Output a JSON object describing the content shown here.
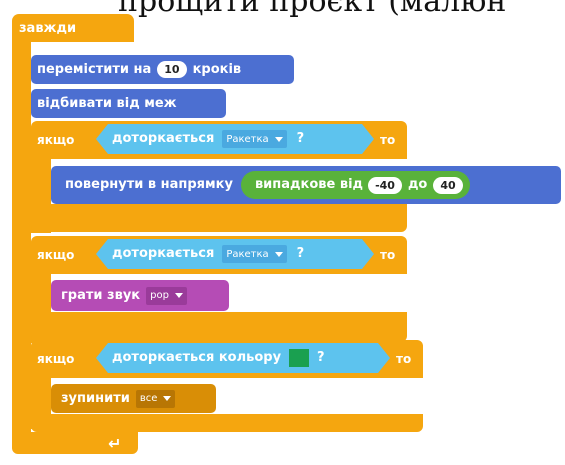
{
  "caption": "прощити проєкт (малюн",
  "script": {
    "forever_label": "завжди",
    "move": {
      "prefix": "перемістити на",
      "steps": "10",
      "suffix": "кроків"
    },
    "bounce_label": "відбивати від меж",
    "if1": {
      "if_label": "якщо",
      "condition": {
        "label": "доторкається",
        "target": "Ракетка",
        "q": "?"
      },
      "then_label": "то",
      "turn": {
        "label": "повернути в напрямку",
        "random": {
          "label": "випадкове від",
          "from": "-40",
          "to_label": "до",
          "to": "40"
        }
      }
    },
    "if2": {
      "if_label": "якщо",
      "condition": {
        "label": "доторкається",
        "target": "Ракетка",
        "q": "?"
      },
      "then_label": "то",
      "sound": {
        "label": "грати звук",
        "sound_name": "pop"
      }
    },
    "if3": {
      "if_label": "якщо",
      "condition": {
        "label": "доторкається кольору",
        "color": "#1aa050",
        "q": "?"
      },
      "then_label": "то",
      "stop": {
        "label": "зупинити",
        "option": "все"
      }
    },
    "loop_arrow_icon": "loop-arrow-icon"
  }
}
